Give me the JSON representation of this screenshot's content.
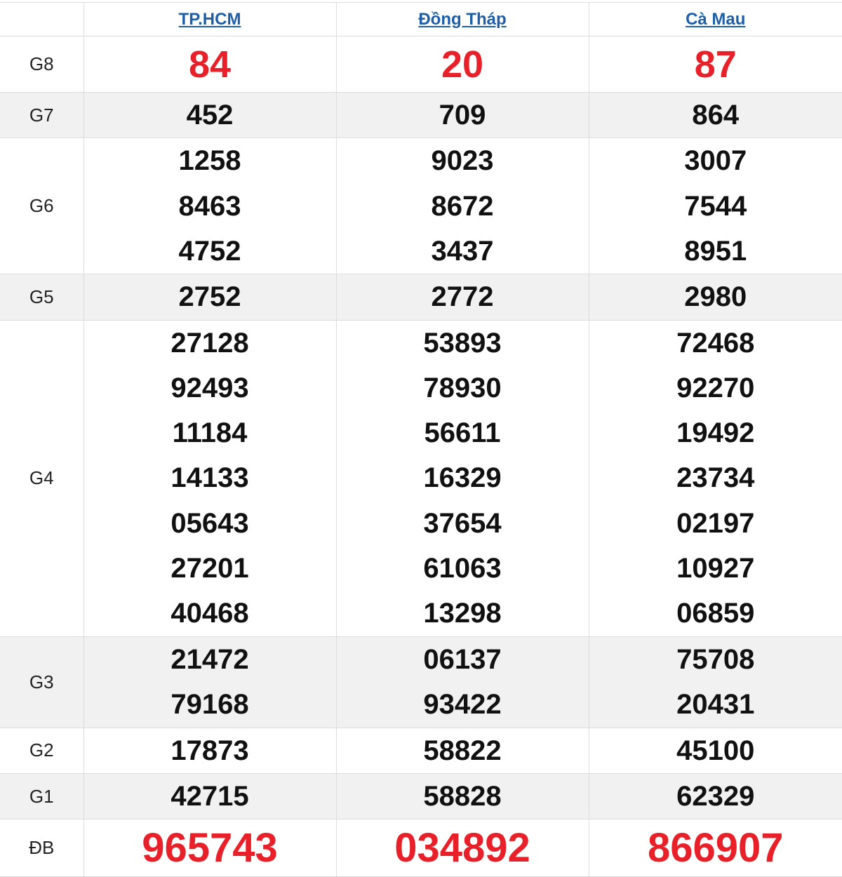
{
  "provinces": [
    {
      "name": "TP.HCM"
    },
    {
      "name": "Đồng Tháp"
    },
    {
      "name": "Cà Mau"
    }
  ],
  "prizes": {
    "g8": {
      "label": "G8",
      "values": [
        "84",
        "20",
        "87"
      ]
    },
    "g7": {
      "label": "G7",
      "values": [
        "452",
        "709",
        "864"
      ]
    },
    "g6": {
      "label": "G6",
      "values": [
        [
          "1258",
          "8463",
          "4752"
        ],
        [
          "9023",
          "8672",
          "3437"
        ],
        [
          "3007",
          "7544",
          "8951"
        ]
      ]
    },
    "g5": {
      "label": "G5",
      "values": [
        "2752",
        "2772",
        "2980"
      ]
    },
    "g4": {
      "label": "G4",
      "values": [
        [
          "27128",
          "92493",
          "11184",
          "14133",
          "05643",
          "27201",
          "40468"
        ],
        [
          "53893",
          "78930",
          "56611",
          "16329",
          "37654",
          "61063",
          "13298"
        ],
        [
          "72468",
          "92270",
          "19492",
          "23734",
          "02197",
          "10927",
          "06859"
        ]
      ]
    },
    "g3": {
      "label": "G3",
      "values": [
        [
          "21472",
          "79168"
        ],
        [
          "06137",
          "93422"
        ],
        [
          "75708",
          "20431"
        ]
      ]
    },
    "g2": {
      "label": "G2",
      "values": [
        "17873",
        "58822",
        "45100"
      ]
    },
    "g1": {
      "label": "G1",
      "values": [
        "42715",
        "58828",
        "62329"
      ]
    },
    "db": {
      "label": "ĐB",
      "values": [
        "965743",
        "034892",
        "866907"
      ]
    }
  },
  "colors": {
    "highlight_red": "#e8202a",
    "link_blue": "#1f5fa8",
    "row_shade": "#f1f1f1",
    "border": "#dddddd"
  }
}
